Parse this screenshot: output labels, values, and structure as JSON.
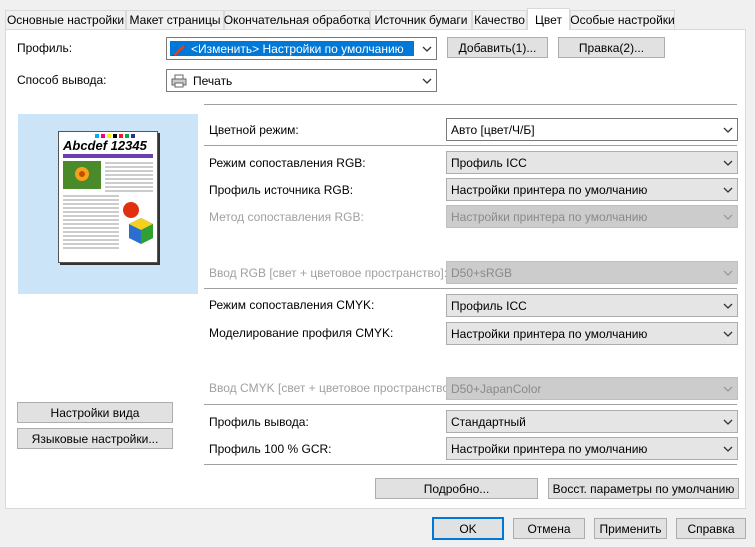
{
  "tabs": [
    {
      "label": "Основные настройки"
    },
    {
      "label": "Макет страницы"
    },
    {
      "label": "Окончательная обработка"
    },
    {
      "label": "Источник бумаги"
    },
    {
      "label": "Качество"
    },
    {
      "label": "Цвет"
    },
    {
      "label": "Особые настройки"
    }
  ],
  "active_tab": "Цвет",
  "profile": {
    "label": "Профиль:",
    "value": "<Изменить> Настройки по умолчанию",
    "add_button": "Добавить(1)...",
    "edit_button": "Правка(2)..."
  },
  "output": {
    "label": "Способ вывода:",
    "value": "Печать"
  },
  "preview": {
    "title": "Abcdef 12345",
    "view_settings_button": "Настройки вида",
    "language_button": "Языковые настройки..."
  },
  "color": {
    "mode_label": "Цветной режим:",
    "mode_value": "Авто [цвет/Ч/Б]",
    "rgb_match_label": "Режим сопоставления RGB:",
    "rgb_match_value": "Профиль ICC",
    "rgb_source_label": "Профиль источника RGB:",
    "rgb_source_value": "Настройки принтера по умолчанию",
    "rgb_method_label": "Метод сопоставления RGB:",
    "rgb_method_value": "Настройки принтера по умолчанию",
    "rgb_input_label": "Ввод RGB [свет + цветовое пространство]:",
    "rgb_input_value": "D50+sRGB",
    "cmyk_match_label": "Режим сопоставления CMYK:",
    "cmyk_match_value": "Профиль ICC",
    "cmyk_sim_label": "Моделирование профиля CMYK:",
    "cmyk_sim_value": "Настройки принтера по умолчанию",
    "cmyk_input_label": "Ввод CMYK [свет + цветовое пространство]:",
    "cmyk_input_value": "D50+JapanColor",
    "out_profile_label": "Профиль вывода:",
    "out_profile_value": "Стандартный",
    "gcr_label": "Профиль 100 % GCR:",
    "gcr_value": "Настройки принтера по умолчанию"
  },
  "details_button": "Подробно...",
  "restore_button": "Восст. параметры по умолчанию",
  "footer": {
    "ok": "OK",
    "cancel": "Отмена",
    "apply": "Применить",
    "help": "Справка"
  },
  "colors": {
    "accent": "#0078d7",
    "preview_bg": "#cce4f7"
  }
}
